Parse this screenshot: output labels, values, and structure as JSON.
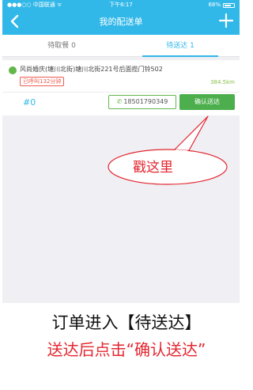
{
  "status_bar": {
    "carrier": "●●●○○ 中国联通 ᯤ",
    "time": "下午6:17",
    "battery": "68%"
  },
  "header": {
    "title": "我的配送单",
    "back_icon": "back-chevron-icon",
    "add_icon": "plus-icon"
  },
  "tabs": [
    {
      "label": "待取餐 0",
      "active": false
    },
    {
      "label": "待送达 1",
      "active": true
    }
  ],
  "order": {
    "address": "风尚婚庆(塘川北街)塘川北街221号后面揽门铃502",
    "call_tag": "已呼叫132分钟",
    "distance": "384.5km",
    "number": "#0",
    "phone": "18501790349",
    "confirm_label": "确认送达"
  },
  "annotation": {
    "bubble_text": "戳这里"
  },
  "captions": {
    "line1": "订单进入【待送达】",
    "line2": "送达后点击“确认送达”"
  },
  "colors": {
    "primary": "#32b8e8",
    "confirm_green": "#4cae4c",
    "annotation_red": "#e3262f"
  }
}
